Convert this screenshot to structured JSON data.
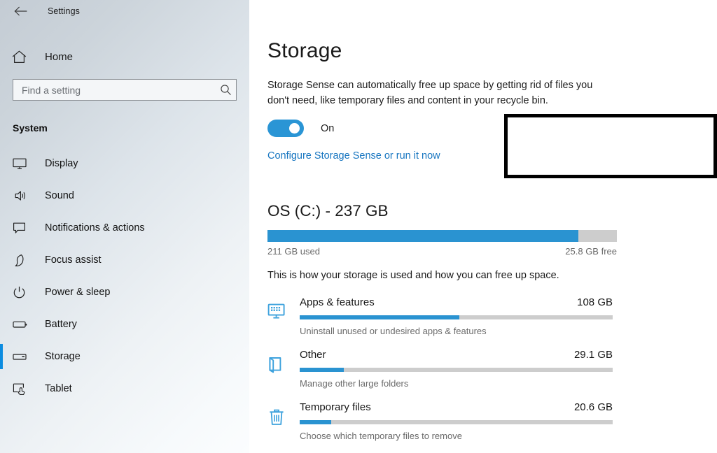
{
  "titlebar": {
    "back_icon": "arrow-left-icon",
    "title": "Settings"
  },
  "sidebar": {
    "home": {
      "label": "Home",
      "icon": "home-icon"
    },
    "search": {
      "value": "",
      "placeholder": "Find a setting",
      "icon": "search-icon"
    },
    "section": "System",
    "accent_color": "#0c8ce0",
    "items": [
      {
        "label": "Display",
        "icon": "monitor-icon",
        "selected": false
      },
      {
        "label": "Sound",
        "icon": "speaker-icon",
        "selected": false
      },
      {
        "label": "Notifications & actions",
        "icon": "comment-icon",
        "selected": false
      },
      {
        "label": "Focus assist",
        "icon": "moon-icon",
        "selected": false
      },
      {
        "label": "Power & sleep",
        "icon": "power-icon",
        "selected": false
      },
      {
        "label": "Battery",
        "icon": "battery-icon",
        "selected": false
      },
      {
        "label": "Storage",
        "icon": "drive-icon",
        "selected": true
      },
      {
        "label": "Tablet",
        "icon": "tablet-hand-icon",
        "selected": false
      }
    ]
  },
  "main": {
    "title": "Storage",
    "intro": "Storage Sense can automatically free up space by getting rid of files you don't need, like temporary files and content in your recycle bin.",
    "storage_sense": {
      "toggle_state": "On",
      "toggle_on": true,
      "toggle_color": "#2a95d5",
      "link": "Configure Storage Sense or run it now",
      "link_color": "#1675c0"
    },
    "annotation": {
      "type": "highlight-box",
      "color": "#000000"
    },
    "drive": {
      "title": "OS (C:) - 237 GB",
      "used_label": "211 GB used",
      "free_label": "25.8 GB free",
      "used_percent": 89,
      "description": "This is how your storage is used and how you can free up space.",
      "bar_fill_color": "#2a93d1",
      "bar_track_color": "#cdcdcd"
    },
    "categories": [
      {
        "name": "Apps & features",
        "size": "108 GB",
        "percent": 51,
        "subtitle": "Uninstall unused or undesired apps & features",
        "icon": "apps-monitor-icon"
      },
      {
        "name": "Other",
        "size": "29.1 GB",
        "percent": 14,
        "subtitle": "Manage other large folders",
        "icon": "folder-open-icon"
      },
      {
        "name": "Temporary files",
        "size": "20.6 GB",
        "percent": 10,
        "subtitle": "Choose which temporary files to remove",
        "icon": "trash-icon"
      }
    ]
  }
}
